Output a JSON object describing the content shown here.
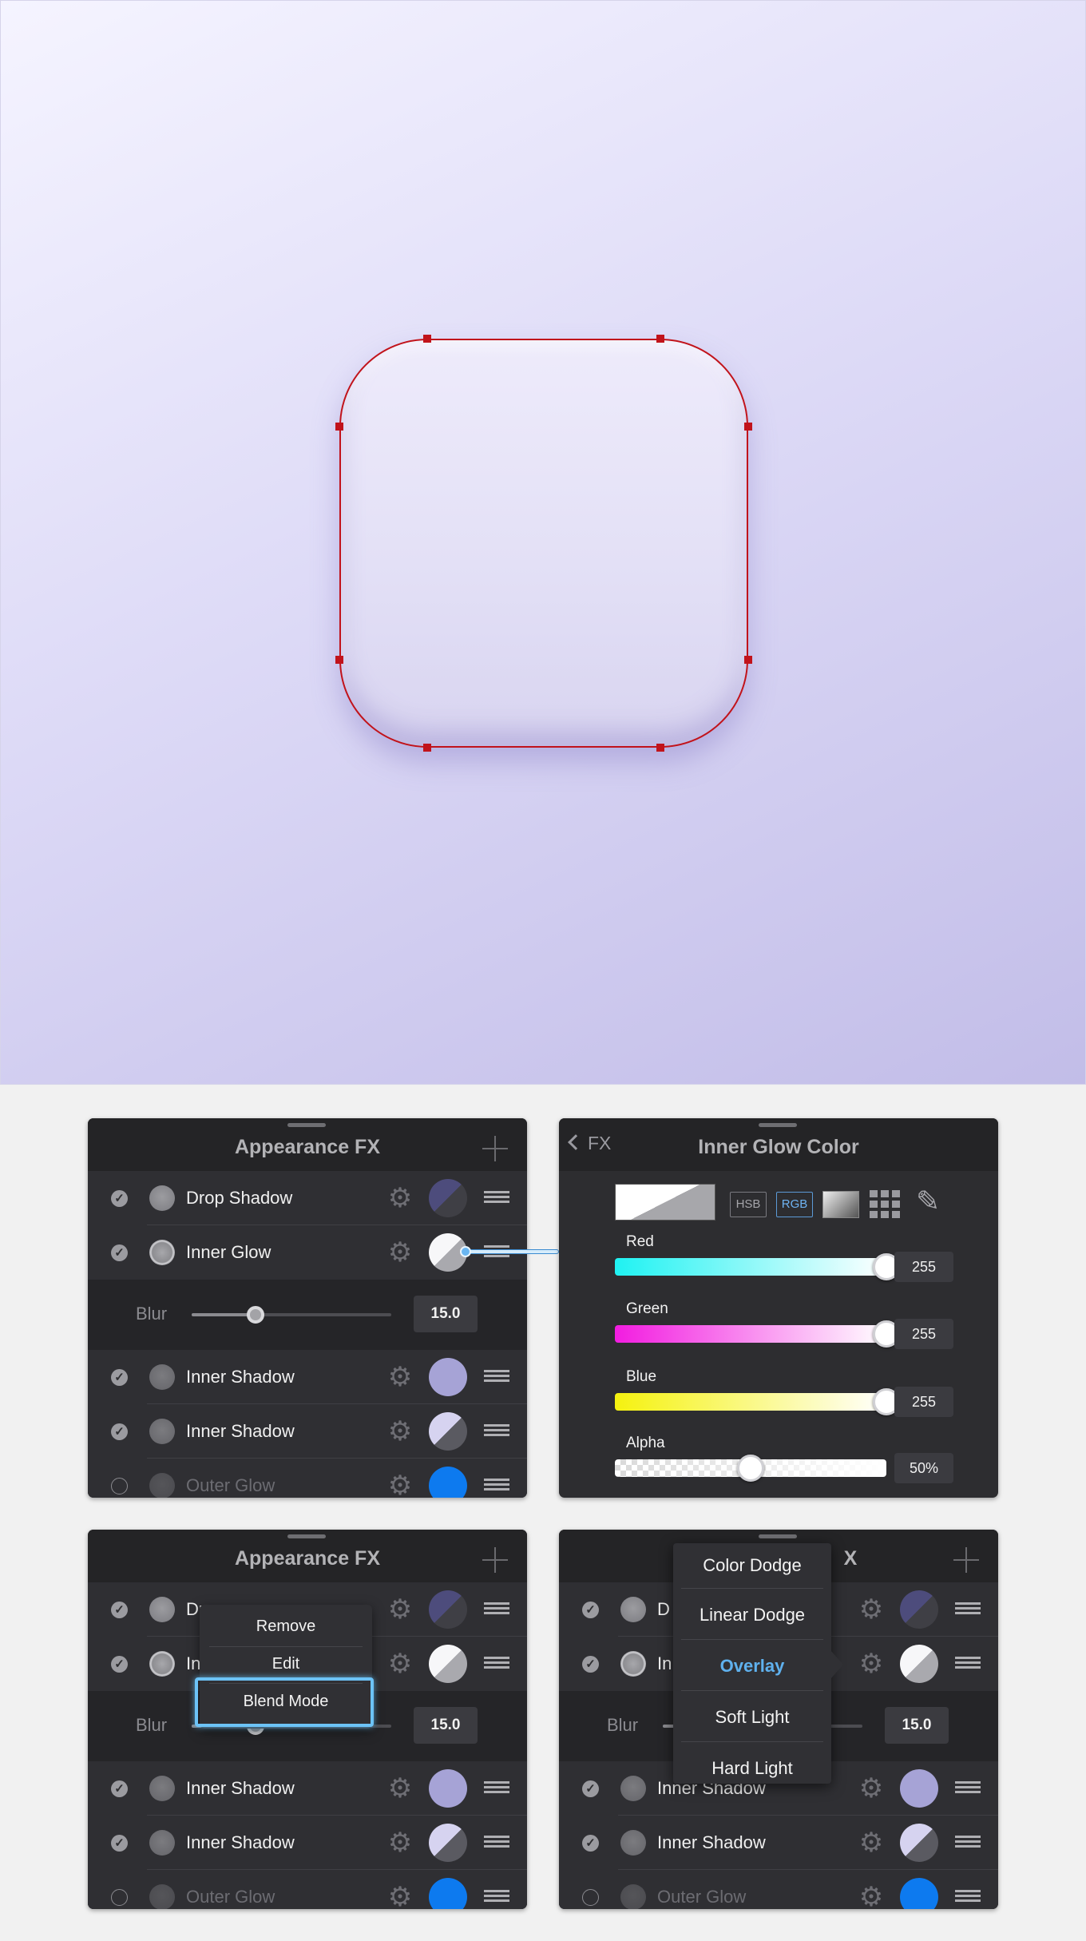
{
  "canvas": {
    "selection_color": "#c1131b",
    "icon_fill": "#e6e3f7"
  },
  "panels": {
    "appearance_title": "Appearance FX",
    "color_title": "Inner Glow Color",
    "back_label": "FX"
  },
  "effects": [
    {
      "label": "Drop Shadow",
      "checked": true
    },
    {
      "label": "Inner Glow",
      "checked": true
    },
    {
      "label": "Inner Shadow",
      "checked": true
    },
    {
      "label": "Inner Shadow",
      "checked": true
    },
    {
      "label": "Outer Glow",
      "checked": false
    }
  ],
  "effects_truncated": {
    "drop_shadow_partial": "Dr",
    "inner_glow_partial": "In",
    "drop_shadow_partial_d": "D",
    "inner_shadow_partial": "Inner Shadow"
  },
  "blur": {
    "label": "Blur",
    "value": "15.0",
    "slider_fraction": 0.32
  },
  "color_picker": {
    "modes": [
      "HSB",
      "RGB"
    ],
    "active_mode": "RGB",
    "channels": [
      {
        "label": "Red",
        "value": "255",
        "fraction": 1.0
      },
      {
        "label": "Green",
        "value": "255",
        "fraction": 1.0
      },
      {
        "label": "Blue",
        "value": "255",
        "fraction": 1.0
      },
      {
        "label": "Alpha",
        "value": "50%",
        "fraction": 0.5
      }
    ],
    "channel_colors": {
      "Red": "#1ff2f2",
      "Green": "#f21ce0",
      "Blue": "#f5f20f"
    }
  },
  "context_menu": {
    "items": [
      "Remove",
      "Edit",
      "Blend Mode"
    ],
    "highlighted": "Blend Mode"
  },
  "blend_menu": {
    "items": [
      "Color Dodge",
      "Linear Dodge",
      "Overlay",
      "Soft Light",
      "Hard Light"
    ],
    "selected": "Overlay"
  },
  "partial_title": "X"
}
